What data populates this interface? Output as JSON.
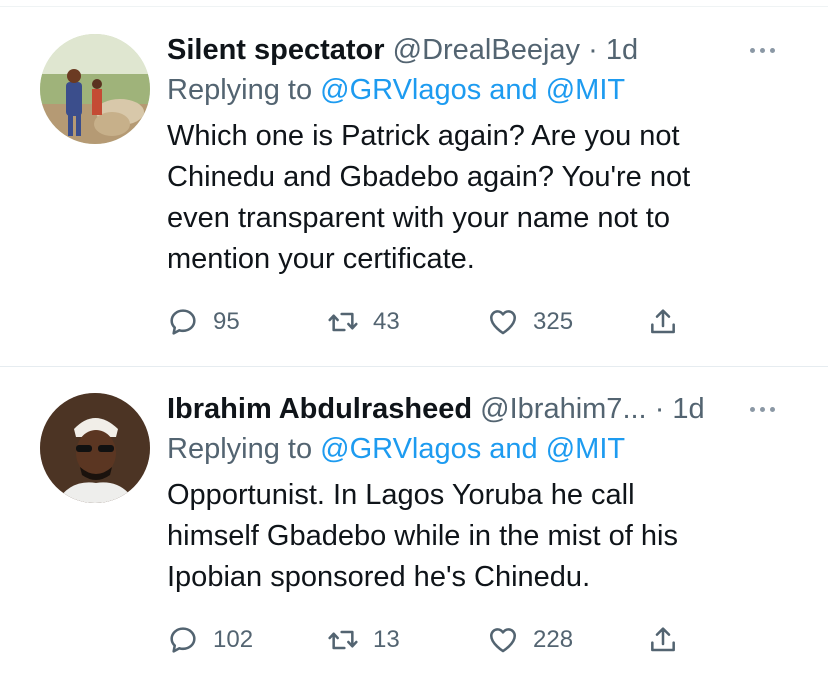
{
  "tweets": [
    {
      "display_name": "Silent spectator",
      "handle": "@DrealBeejay",
      "separator": "·",
      "time": "1d",
      "replying_prefix": "Replying to",
      "replying_mentions": "@GRVlagos and @MIT",
      "lines": [
        "Which one is Patrick again? Are you not",
        "Chinedu and Gbadebo again? You're not",
        "even transparent with your name not to",
        "mention your certificate."
      ],
      "replies": "95",
      "retweets": "43",
      "likes": "325"
    },
    {
      "display_name": "Ibrahim Abdulrasheed",
      "handle": "@Ibrahim7...",
      "separator": "·",
      "time": "1d",
      "replying_prefix": "Replying to",
      "replying_mentions": "@GRVlagos and @MIT",
      "lines": [
        "Opportunist. In Lagos Yoruba he call",
        "himself Gbadebo while in the mist of his",
        "Ipobian sponsored he's Chinedu."
      ],
      "replies": "102",
      "retweets": "13",
      "likes": "228"
    }
  ],
  "icons": {
    "reply": "reply-icon",
    "retweet": "retweet-icon",
    "like": "heart-icon",
    "share": "share-icon",
    "more": "more-icon"
  },
  "colors": {
    "text": "#0f1419",
    "secondary": "#536471",
    "link": "#1d9bf0"
  }
}
